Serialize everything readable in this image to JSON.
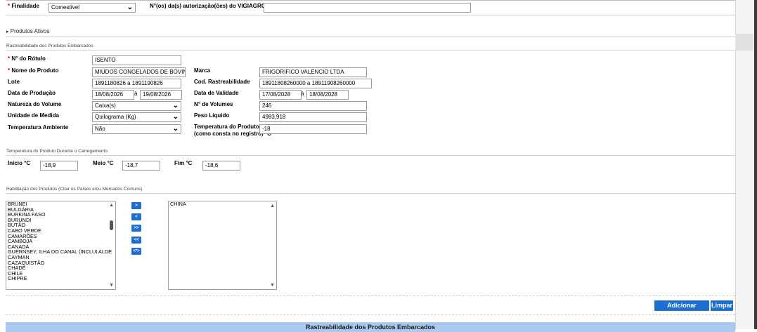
{
  "finalidade": {
    "label": "Finalidade",
    "required": "*",
    "value": "Comestível"
  },
  "vigiagro": {
    "label": "N°(os) da(s) autorização(ões) do VIGIAGRO",
    "value": ""
  },
  "produtos_ativos": {
    "arrow": "▸",
    "label": "Produtos Ativos"
  },
  "rastreabilidade": {
    "title": "Rastreabilidade dos Produtos Embarcados",
    "rotulo": {
      "label": "N° do Rótulo",
      "required": "*",
      "value": "ISENTO"
    },
    "nome_produto": {
      "label": "Nome do Produto",
      "required": "*",
      "value": "MIUDOS CONGELADOS DE BOVINO"
    },
    "marca": {
      "label": "Marca",
      "value": "FRIGORIFICO VALENCIO LTDA"
    },
    "lote": {
      "label": "Lote",
      "value": "1891180826 a 1891190826"
    },
    "cod_rastreabilidade": {
      "label": "Cod. Rastreabilidade",
      "value": "18911808260000 a 18911908260000"
    },
    "data_producao": {
      "label": "Data de Produção",
      "from": "18/08/2026",
      "sep": "à",
      "to": "19/08/2026"
    },
    "data_validade": {
      "label": "Data de Validade",
      "from": "17/08/2028",
      "sep": "à",
      "to": "18/08/2028"
    },
    "natureza_volume": {
      "label": "Natureza do Volume",
      "value": "Caixa(s)"
    },
    "num_volumes": {
      "label": "N° de Volumes",
      "value": "246"
    },
    "unidade_medida": {
      "label": "Unidade de Medida",
      "value": "Quilograma (Kg)"
    },
    "peso_liquido": {
      "label": "Peso Líquido",
      "value": "4983,918"
    },
    "temp_ambiente": {
      "label": "Temperatura Ambiente",
      "value": "Não"
    },
    "temp_produto": {
      "label_line1": "Temperatura do Produto",
      "label_line2": "(como consta no registro) °C",
      "value": "-18"
    }
  },
  "carregamento": {
    "title": "Temperatura do Produto Durante o Carregamento",
    "inicio": {
      "label": "Início °C",
      "value": "-18,9"
    },
    "meio": {
      "label": "Meio °C",
      "value": "-18,7"
    },
    "fim": {
      "label": "Fim °C",
      "value": "-18,6"
    }
  },
  "habilitacao": {
    "title": "Habilitação dos Produtos (Citar os Países e/ou Mercados Comuns)",
    "available": [
      "BRUNEI",
      "BULGÁRIA",
      "BURKINA FASO",
      "BURUNDI",
      "BUTÃO",
      "CABO VERDE",
      "CAMARÕES",
      "CAMBOJA",
      "CANADÁ",
      "GUERNSEY, ILHA DO CANAL (INCLUI ALDE",
      "CAYMAN",
      "CAZAQUISTÃO",
      "CHADE",
      "CHILE",
      "CHIPRE"
    ],
    "selected": [
      "CHINA"
    ],
    "buttons": [
      ">",
      "<",
      ">>",
      "<<",
      "<*>"
    ]
  },
  "actions": {
    "add_label": "Adicionar Produto",
    "clear_label": "Limpar"
  },
  "bottom_header": "Rastreabilidade dos Produtos Embarcados",
  "colors": {
    "accent": "#1e6fd0",
    "header_bg": "#a9c9f0",
    "required": "#e00000"
  }
}
